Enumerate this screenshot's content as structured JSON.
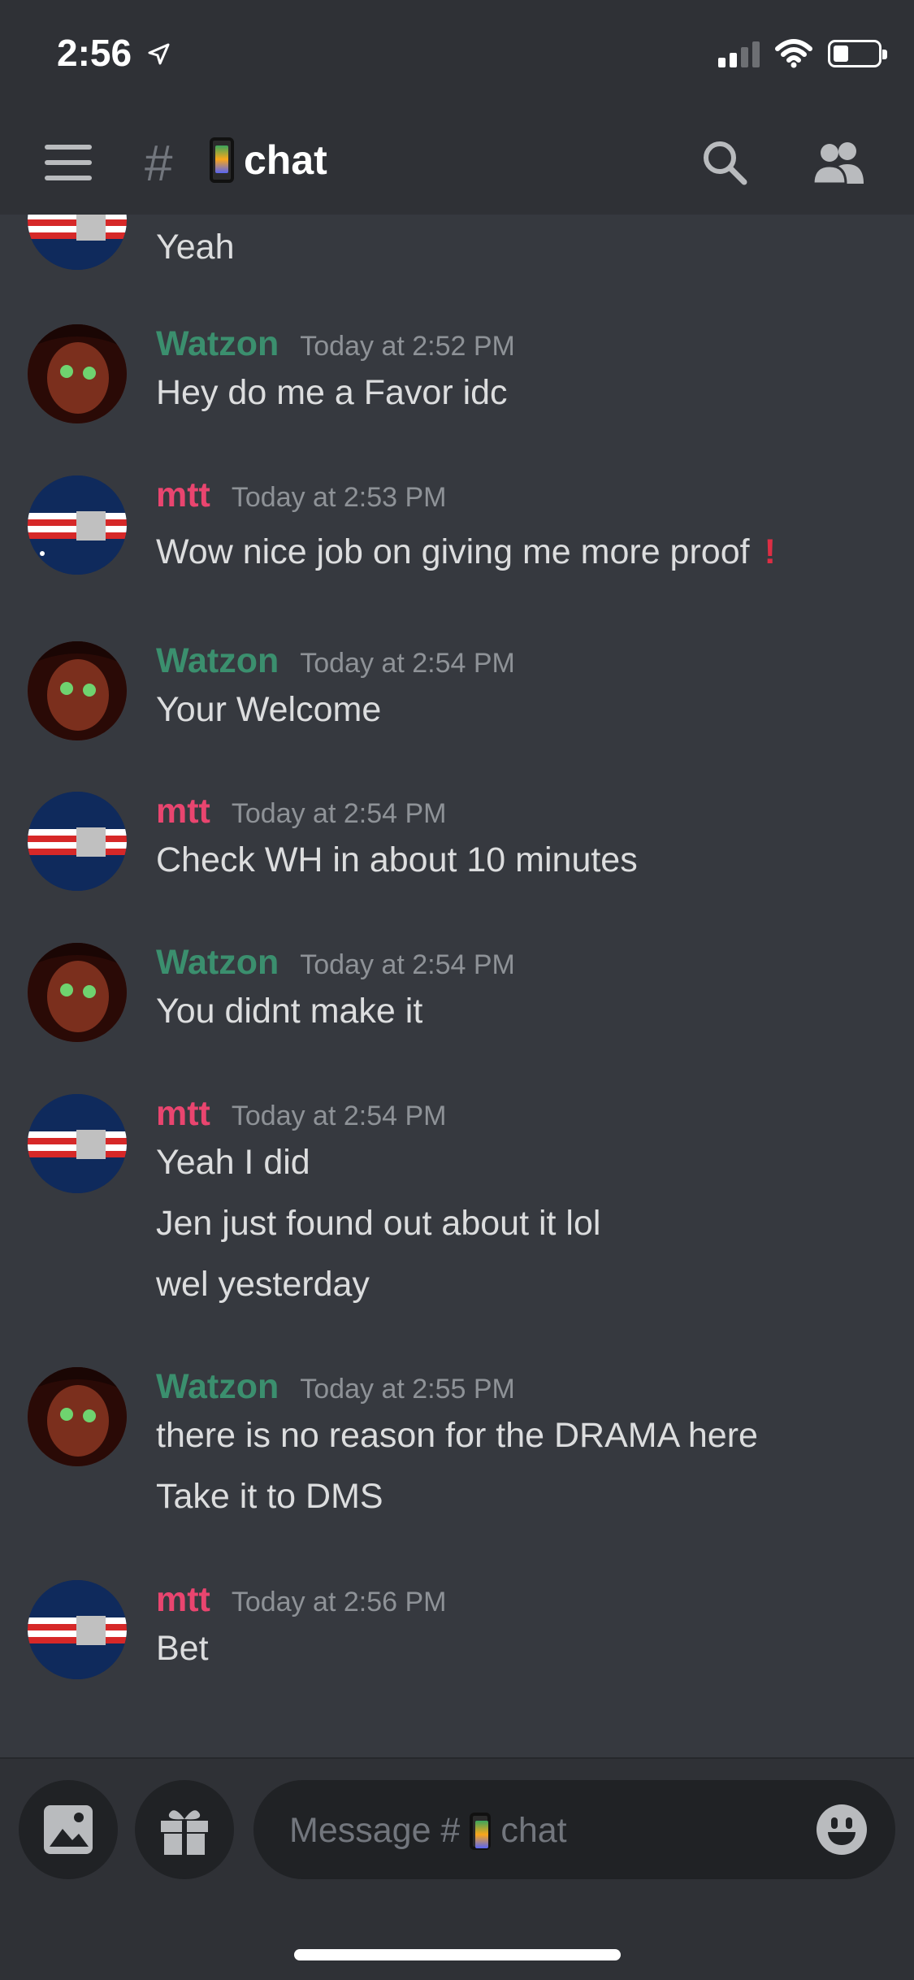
{
  "status_bar": {
    "time": "2:56"
  },
  "header": {
    "channel_name": "chat",
    "channel_prefix": "#"
  },
  "messages": [
    {
      "author": "",
      "timestamp": "",
      "lines": [
        "Yeah"
      ]
    },
    {
      "author": "Watzon",
      "timestamp": "Today at 2:52 PM",
      "lines": [
        "Hey do me a Favor idc"
      ]
    },
    {
      "author": "mtt",
      "timestamp": "Today at 2:53 PM",
      "lines": [
        "Wow nice job on giving me more proof"
      ]
    },
    {
      "author": "Watzon",
      "timestamp": "Today at 2:54 PM",
      "lines": [
        "Your Welcome"
      ]
    },
    {
      "author": "mtt",
      "timestamp": "Today at 2:54 PM",
      "lines": [
        "Check WH in about 10 minutes"
      ]
    },
    {
      "author": "Watzon",
      "timestamp": "Today at 2:54 PM",
      "lines": [
        "You didnt make it"
      ]
    },
    {
      "author": "mtt",
      "timestamp": "Today at 2:54 PM",
      "lines": [
        "Yeah I did",
        "Jen just found out about it lol",
        "wel yesterday"
      ]
    },
    {
      "author": "Watzon",
      "timestamp": "Today at 2:55 PM",
      "lines": [
        "there is no reason for the DRAMA here",
        "Take it to DMS"
      ]
    },
    {
      "author": "mtt",
      "timestamp": "Today at 2:56 PM",
      "lines": [
        "Bet"
      ]
    }
  ],
  "composer": {
    "placeholder_prefix": "Message #",
    "placeholder_channel": "chat"
  },
  "colors": {
    "watzon": "#3b8f6e",
    "mtt": "#e9456f",
    "background": "#36393f",
    "header": "#2f3136"
  }
}
